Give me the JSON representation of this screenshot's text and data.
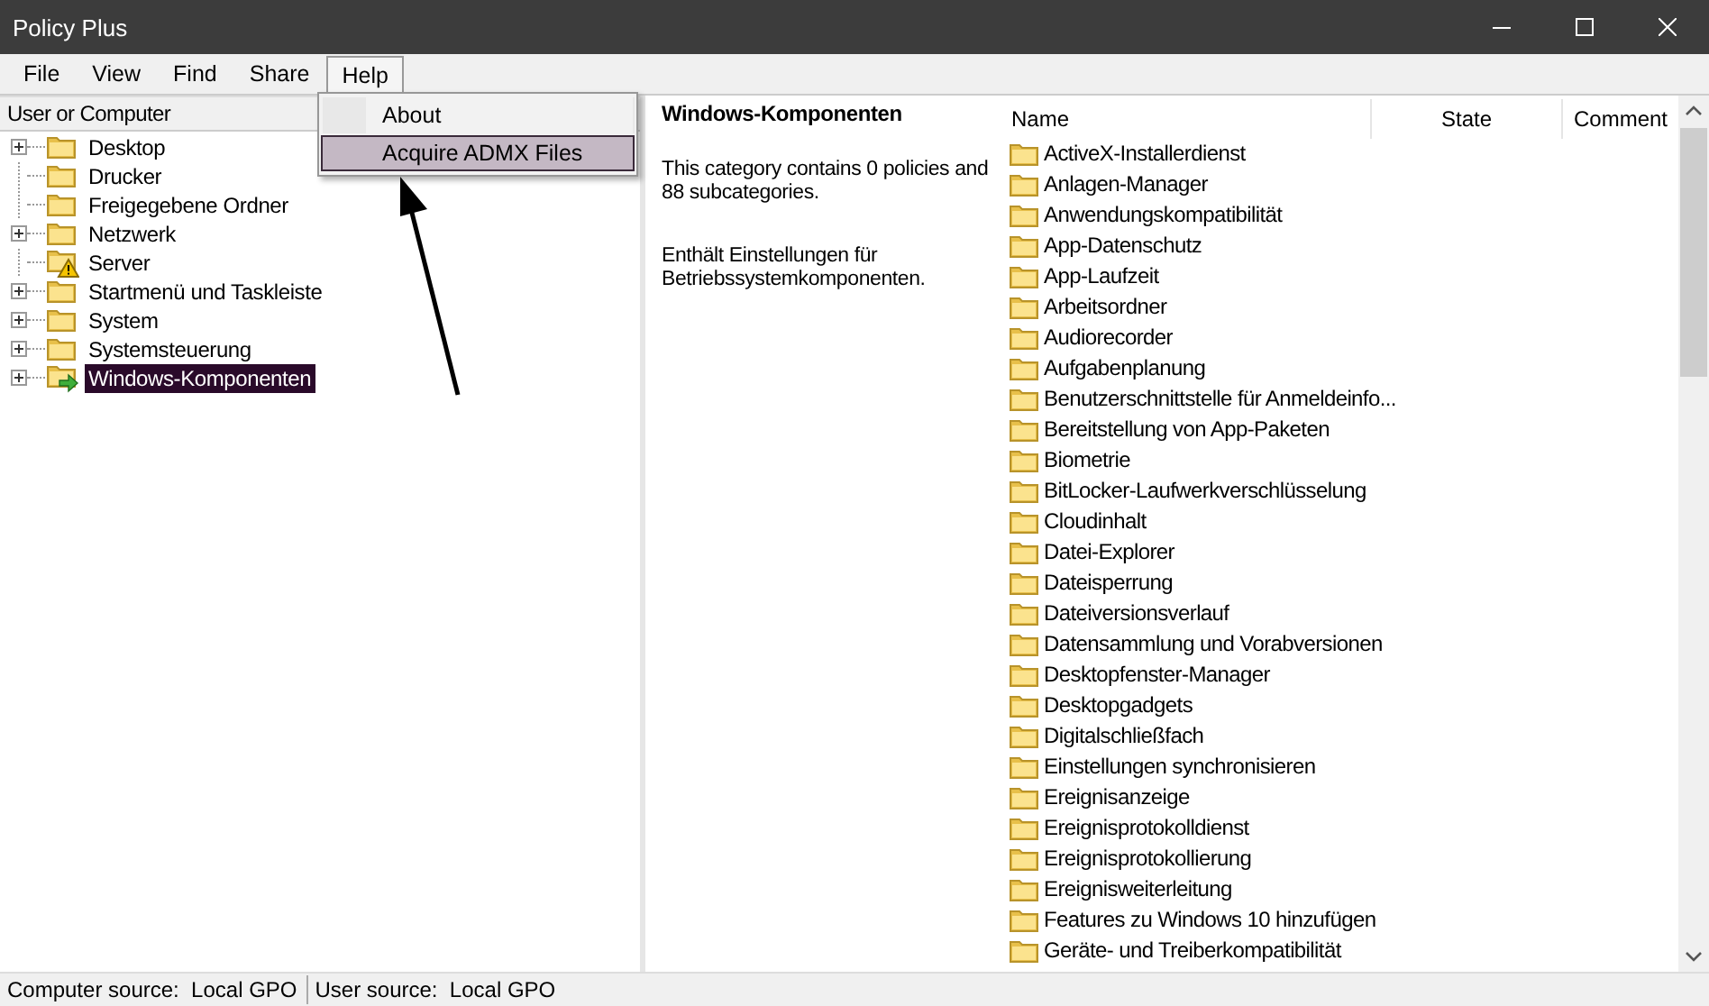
{
  "window": {
    "title": "Policy Plus"
  },
  "menu_bar": [
    {
      "label": "File",
      "selected": false
    },
    {
      "label": "View",
      "selected": false
    },
    {
      "label": "Find",
      "selected": false
    },
    {
      "label": "Share",
      "selected": false
    },
    {
      "label": "Help",
      "selected": true
    }
  ],
  "help_menu": [
    {
      "label": "About",
      "selected": false
    },
    {
      "label": "Acquire ADMX Files",
      "selected": true
    }
  ],
  "tree": {
    "header": "User or Computer",
    "items": [
      {
        "label": "Desktop",
        "kind": "folder",
        "expandable": true,
        "selected": false
      },
      {
        "label": "Drucker",
        "kind": "folder",
        "expandable": false,
        "selected": false
      },
      {
        "label": "Freigegebene Ordner",
        "kind": "folder",
        "expandable": false,
        "selected": false
      },
      {
        "label": "Netzwerk",
        "kind": "folder",
        "expandable": true,
        "selected": false
      },
      {
        "label": "Server",
        "kind": "warning",
        "expandable": false,
        "selected": false
      },
      {
        "label": "Startmenü und Taskleiste",
        "kind": "folder",
        "expandable": true,
        "selected": false
      },
      {
        "label": "System",
        "kind": "folder",
        "expandable": true,
        "selected": false
      },
      {
        "label": "Systemsteuerung",
        "kind": "folder",
        "expandable": true,
        "selected": false
      },
      {
        "label": "Windows-Komponenten",
        "kind": "shortcut",
        "expandable": true,
        "selected": true
      }
    ]
  },
  "details": {
    "title": "Windows-Komponenten",
    "summary": "This category contains 0 policies and 88 subcategories.",
    "description": "Enthält Einstellungen für Betriebssystemkomponenten."
  },
  "list": {
    "columns": [
      "Name",
      "State",
      "Comment"
    ],
    "rows": [
      "ActiveX-Installerdienst",
      "Anlagen-Manager",
      "Anwendungskompatibilität",
      "App-Datenschutz",
      "App-Laufzeit",
      "Arbeitsordner",
      "Audiorecorder",
      "Aufgabenplanung",
      "Benutzerschnittstelle für Anmeldeinfo...",
      "Bereitstellung von App-Paketen",
      "Biometrie",
      "BitLocker-Laufwerkverschlüsselung",
      "Cloudinhalt",
      "Datei-Explorer",
      "Dateisperrung",
      "Dateiversionsverlauf",
      "Datensammlung und Vorabversionen",
      "Desktopfenster-Manager",
      "Desktopgadgets",
      "Digitalschließfach",
      "Einstellungen synchronisieren",
      "Ereignisanzeige",
      "Ereignisprotokolldienst",
      "Ereignisprotokollierung",
      "Ereignisweiterleitung",
      "Features zu Windows 10 hinzufügen",
      "Geräte- und Treiberkompatibilität"
    ]
  },
  "status_bar": [
    "Computer source:  Local GPO",
    "User source:  Local GPO"
  ]
}
